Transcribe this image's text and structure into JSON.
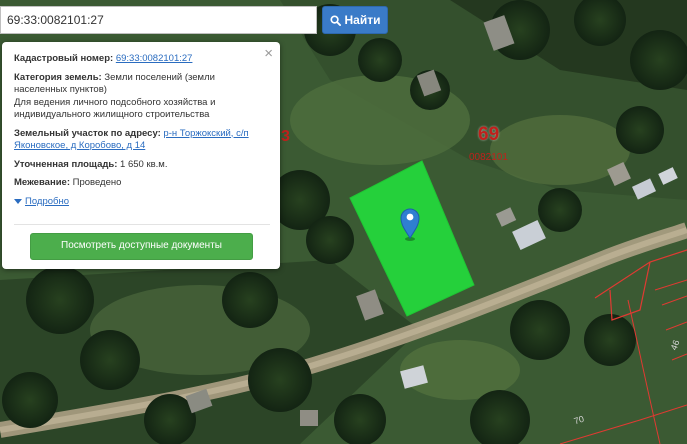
{
  "search": {
    "value": "69:33:0082101:27",
    "button_label": "Найти"
  },
  "popup": {
    "cad_label": "Кадастровый номер:",
    "cad_value": "69:33:0082101:27",
    "category_label": "Категория земель:",
    "category_value": "Земли поселений (земли населенных пунктов)",
    "use_value": "Для ведения личного подсобного хозяйства и индивидуального жилищного строительства",
    "address_label": "Земельный участок по адресу:",
    "address_value": "р-н Торжокский, с/п Яконовское, д Коробово, д 14",
    "area_label": "Уточненная площадь:",
    "area_value": "1 650 кв.м.",
    "survey_label": "Межевание:",
    "survey_value": "Проведено",
    "details_link": "Подробно",
    "docs_button": "Посмотреть доступные документы",
    "close_symbol": "×"
  },
  "map": {
    "block_number": "69",
    "block_code": "0082101",
    "cut_label": "3",
    "road_label_a": "70",
    "road_label_b": "46"
  },
  "colors": {
    "parcel_fill": "#22e03c",
    "marker": "#2f7fd1",
    "boundary": "#e03a32",
    "search_button": "#3a7bc8",
    "docs_button": "#4cae4c"
  },
  "icons": {
    "search_button_icon": "search-icon",
    "close": "close-icon",
    "marker": "map-marker-icon",
    "details": "triangle-down-icon"
  }
}
